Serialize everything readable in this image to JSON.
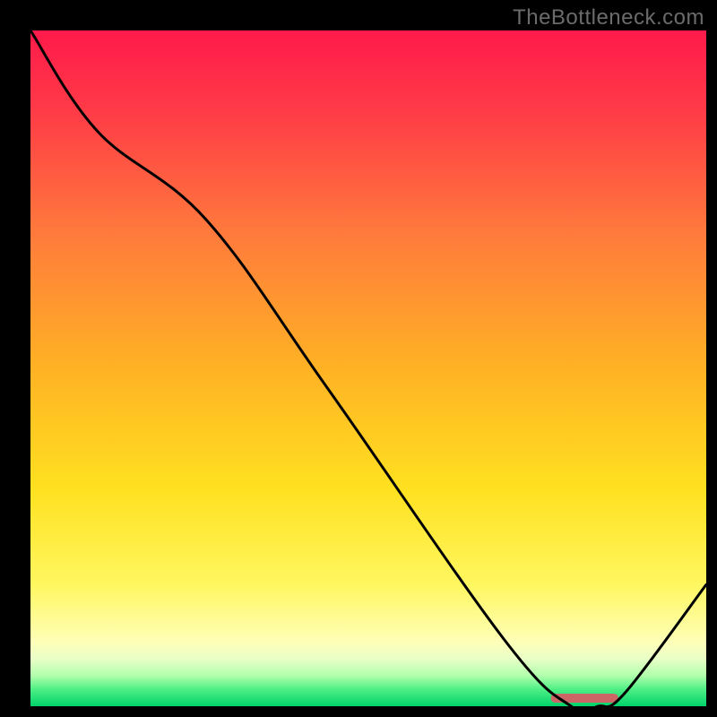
{
  "watermark": "TheBottleneck.com",
  "chart_data": {
    "type": "line",
    "title": "",
    "xlabel": "",
    "ylabel": "",
    "x": [
      0,
      10,
      26,
      44,
      70,
      80,
      84,
      88,
      100
    ],
    "values": [
      100,
      85,
      72,
      47,
      10,
      0,
      0,
      2,
      18
    ],
    "ylim": [
      0,
      100
    ],
    "xlim": [
      0,
      100
    ],
    "annotations": [
      {
        "name": "plateau-marker",
        "x_from": 77,
        "x_to": 87,
        "y": 1.2,
        "color": "#cc6666"
      }
    ],
    "background_gradient": [
      {
        "stop": 0.0,
        "color": "#ff1a4b"
      },
      {
        "stop": 0.12,
        "color": "#ff3b47"
      },
      {
        "stop": 0.3,
        "color": "#ff7a3c"
      },
      {
        "stop": 0.5,
        "color": "#ffb224"
      },
      {
        "stop": 0.68,
        "color": "#ffe120"
      },
      {
        "stop": 0.82,
        "color": "#fff760"
      },
      {
        "stop": 0.905,
        "color": "#feffb8"
      },
      {
        "stop": 0.93,
        "color": "#e9ffc7"
      },
      {
        "stop": 0.955,
        "color": "#b0ffac"
      },
      {
        "stop": 0.975,
        "color": "#4eef85"
      },
      {
        "stop": 1.0,
        "color": "#00d36a"
      }
    ]
  }
}
